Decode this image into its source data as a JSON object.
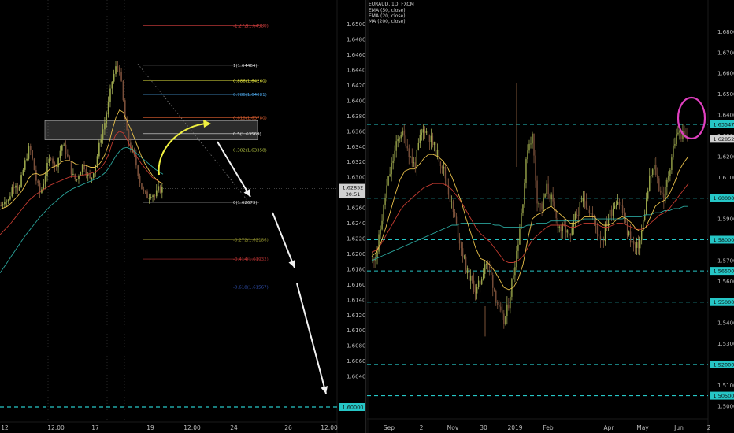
{
  "chart_data": [
    {
      "type": "candlestick",
      "panel": "left",
      "x_tick_labels": [
        "12",
        "12:00",
        "17",
        "19",
        "12:00",
        "24",
        "26",
        "12:00"
      ],
      "y_tick_labels": [
        "1.65000",
        "1.64800",
        "1.64600",
        "1.64400",
        "1.64200",
        "1.64000",
        "1.63800",
        "1.63600",
        "1.63400",
        "1.63200",
        "1.63000",
        "1.62800",
        "1.62600",
        "1.62400",
        "1.62200",
        "1.62000",
        "1.61800",
        "1.61600",
        "1.61400",
        "1.61200",
        "1.61000",
        "1.60800",
        "1.60600",
        "1.60400"
      ],
      "ylim": [
        1.6,
        1.6513
      ],
      "price_tag": {
        "price": 1.62852,
        "label": "1.62852",
        "countdown": "30:51"
      },
      "level_tag": {
        "price": 1.6,
        "label": "1.60000"
      },
      "fib_levels": [
        {
          "label": "-1.272(1.64980)",
          "price": 1.6498,
          "color": "#d84040"
        },
        {
          "label": "1(1.64464)",
          "price": 1.64464,
          "color": "#e0e0e0"
        },
        {
          "label": "0.886(1.64260)",
          "price": 1.6426,
          "color": "#e8e840"
        },
        {
          "label": "0.786(1.64081)",
          "price": 1.64081,
          "color": "#4aa0e0"
        },
        {
          "label": "0.618(1.63780)",
          "price": 1.6378,
          "color": "#e06030"
        },
        {
          "label": "0.5(1.63569)",
          "price": 1.63569,
          "color": "#e0e0e0"
        },
        {
          "label": "0.382(1.63358)",
          "price": 1.63358,
          "color": "#b0c040"
        },
        {
          "label": "0(1.62673)",
          "price": 1.62673,
          "color": "#e0e0e0"
        },
        {
          "label": "-0.272(1.62186)",
          "price": 1.62186,
          "color": "#9a9a30"
        },
        {
          "label": "-0.414(1.61932)",
          "price": 1.61932,
          "color": "#b03030"
        },
        {
          "label": "-0.618(1.61567)",
          "price": 1.61567,
          "color": "#3050b0"
        }
      ],
      "zone": {
        "top": 1.6374,
        "bottom": 1.6349
      },
      "dashed_level": 1.6,
      "series": [
        {
          "key": "price_path",
          "values": [
            1.6263,
            1.6272,
            1.6268,
            1.6285,
            1.6295,
            1.6282,
            1.6305,
            1.6325,
            1.634,
            1.6318,
            1.6292,
            1.6278,
            1.6296,
            1.6315,
            1.633,
            1.6312,
            1.6325,
            1.6343,
            1.6335,
            1.632,
            1.6302,
            1.6295,
            1.6308,
            1.6318,
            1.6305,
            1.6295,
            1.6312,
            1.633,
            1.6355,
            1.6372,
            1.6395,
            1.6425,
            1.6442,
            1.6446,
            1.6405,
            1.636,
            1.634,
            1.633,
            1.6312,
            1.629,
            1.6278,
            1.6275,
            1.628,
            1.6275,
            1.6284,
            1.6285
          ]
        },
        {
          "key": "ema50",
          "values": [
            1.6225,
            1.623,
            1.6235,
            1.624,
            1.6246,
            1.6252,
            1.6258,
            1.6264,
            1.627,
            1.6274,
            1.6278,
            1.6281,
            1.6284,
            1.6287,
            1.629,
            1.6292,
            1.6294,
            1.6296,
            1.6298,
            1.63,
            1.6301,
            1.6301,
            1.6302,
            1.6303,
            1.6304,
            1.6305,
            1.6307,
            1.6309,
            1.6313,
            1.632,
            1.633,
            1.6345,
            1.6356,
            1.636,
            1.6358,
            1.635,
            1.634,
            1.6332,
            1.6325,
            1.6318,
            1.6312,
            1.6306,
            1.63,
            1.6297,
            1.6294,
            1.6292
          ]
        },
        {
          "key": "ema20",
          "values": [
            1.6258,
            1.626,
            1.6262,
            1.6266,
            1.6271,
            1.6276,
            1.6282,
            1.629,
            1.6299,
            1.6304,
            1.6305,
            1.6303,
            1.6304,
            1.6307,
            1.6312,
            1.6314,
            1.6316,
            1.632,
            1.6322,
            1.6322,
            1.632,
            1.6317,
            1.6316,
            1.6316,
            1.6315,
            1.6313,
            1.6313,
            1.6315,
            1.6321,
            1.633,
            1.6343,
            1.6362,
            1.6378,
            1.6388,
            1.6385,
            1.6374,
            1.6364,
            1.6352,
            1.634,
            1.6328,
            1.6318,
            1.631,
            1.6303,
            1.6298,
            1.6294,
            1.6292
          ]
        },
        {
          "key": "ma200",
          "values": [
            1.6175,
            1.6182,
            1.6189,
            1.6196,
            1.6203,
            1.621,
            1.6217,
            1.6224,
            1.623,
            1.6236,
            1.6242,
            1.6248,
            1.6253,
            1.6258,
            1.6263,
            1.6267,
            1.6271,
            1.6275,
            1.6279,
            1.6282,
            1.6285,
            1.6287,
            1.6289,
            1.6291,
            1.6293,
            1.6295,
            1.6297,
            1.6299,
            1.6302,
            1.6306,
            1.6312,
            1.632,
            1.6328,
            1.6334,
            1.6338,
            1.6339,
            1.6337,
            1.6334,
            1.633,
            1.6326,
            1.6322,
            1.6318,
            1.6314,
            1.631,
            1.6307,
            1.6304
          ]
        }
      ]
    },
    {
      "type": "candlestick",
      "panel": "right",
      "title": "EURAUD, 1D, FXCM",
      "legend": [
        "EMA (50, close)",
        "EMA (20, close)",
        "MA (200, close)"
      ],
      "x_tick_labels": [
        "Sep",
        "2",
        "Nov",
        "30",
        "2019",
        "Feb",
        "Apr",
        "May",
        "Jun",
        "2"
      ],
      "y_tick_labels": [
        "1.68000",
        "1.67000",
        "1.66000",
        "1.65000",
        "1.64000",
        "1.63000",
        "1.62000",
        "1.61000",
        "1.60000",
        "1.59000",
        "1.58000",
        "1.57000",
        "1.56000",
        "1.55000",
        "1.54000",
        "1.53000",
        "1.52000",
        "1.51000",
        "1.50000"
      ],
      "ylim": [
        1.495,
        1.6915
      ],
      "price_tag": {
        "price": 1.62852,
        "label": "1.62852"
      },
      "dashed_levels": [
        {
          "price": 1.63547,
          "label": "1.63547"
        },
        {
          "price": 1.6,
          "label": "1.60000"
        },
        {
          "price": 1.58,
          "label": "1.58000"
        },
        {
          "price": 1.565,
          "label": "1.56500"
        },
        {
          "price": 1.55,
          "label": "1.55000"
        },
        {
          "price": 1.52,
          "label": "1.52000"
        },
        {
          "price": 1.505,
          "label": "1.50500"
        }
      ],
      "series": [
        {
          "key": "price_path",
          "values": [
            1.57,
            1.575,
            1.59,
            1.605,
            1.615,
            1.625,
            1.632,
            1.628,
            1.62,
            1.615,
            1.628,
            1.634,
            1.63,
            1.625,
            1.62,
            1.615,
            1.605,
            1.595,
            1.585,
            1.575,
            1.565,
            1.56,
            1.555,
            1.56,
            1.57,
            1.565,
            1.555,
            1.545,
            1.54,
            1.55,
            1.565,
            1.58,
            1.6,
            1.625,
            1.63,
            1.6,
            1.595,
            1.605,
            1.6,
            1.59,
            1.585,
            1.585,
            1.58,
            1.59,
            1.595,
            1.6,
            1.595,
            1.59,
            1.583,
            1.58,
            1.59,
            1.595,
            1.6,
            1.595,
            1.585,
            1.58,
            1.575,
            1.58,
            1.595,
            1.61,
            1.615,
            1.605,
            1.6,
            1.612,
            1.625,
            1.632,
            1.63,
            1.628
          ]
        },
        {
          "key": "ema50",
          "values": [
            1.574,
            1.575,
            1.578,
            1.582,
            1.586,
            1.59,
            1.594,
            1.597,
            1.599,
            1.601,
            1.603,
            1.605,
            1.606,
            1.607,
            1.607,
            1.607,
            1.606,
            1.604,
            1.601,
            1.598,
            1.594,
            1.59,
            1.586,
            1.583,
            1.581,
            1.579,
            1.576,
            1.573,
            1.57,
            1.569,
            1.569,
            1.57,
            1.572,
            1.576,
            1.58,
            1.582,
            1.584,
            1.586,
            1.587,
            1.587,
            1.587,
            1.587,
            1.586,
            1.586,
            1.587,
            1.588,
            1.588,
            1.588,
            1.587,
            1.586,
            1.586,
            1.587,
            1.588,
            1.588,
            1.587,
            1.586,
            1.585,
            1.585,
            1.586,
            1.588,
            1.59,
            1.592,
            1.593,
            1.595,
            1.598,
            1.601,
            1.604,
            1.607
          ]
        },
        {
          "key": "ema20",
          "values": [
            1.572,
            1.574,
            1.579,
            1.586,
            1.594,
            1.602,
            1.609,
            1.613,
            1.614,
            1.614,
            1.616,
            1.619,
            1.621,
            1.621,
            1.62,
            1.618,
            1.615,
            1.61,
            1.604,
            1.598,
            1.59,
            1.583,
            1.576,
            1.571,
            1.57,
            1.568,
            1.565,
            1.561,
            1.557,
            1.556,
            1.557,
            1.561,
            1.568,
            1.58,
            1.59,
            1.592,
            1.593,
            1.595,
            1.596,
            1.594,
            1.592,
            1.59,
            1.588,
            1.588,
            1.589,
            1.591,
            1.591,
            1.591,
            1.589,
            1.587,
            1.587,
            1.588,
            1.59,
            1.591,
            1.59,
            1.588,
            1.585,
            1.584,
            1.586,
            1.591,
            1.596,
            1.598,
            1.599,
            1.602,
            1.607,
            1.613,
            1.617,
            1.62
          ]
        },
        {
          "key": "ma200",
          "values": [
            1.57,
            1.571,
            1.572,
            1.573,
            1.574,
            1.575,
            1.576,
            1.577,
            1.578,
            1.579,
            1.58,
            1.581,
            1.582,
            1.583,
            1.584,
            1.585,
            1.586,
            1.587,
            1.587,
            1.588,
            1.588,
            1.588,
            1.588,
            1.588,
            1.588,
            1.588,
            1.587,
            1.587,
            1.586,
            1.586,
            1.586,
            1.586,
            1.586,
            1.587,
            1.587,
            1.588,
            1.588,
            1.588,
            1.589,
            1.589,
            1.589,
            1.589,
            1.589,
            1.589,
            1.589,
            1.59,
            1.59,
            1.59,
            1.59,
            1.59,
            1.59,
            1.59,
            1.59,
            1.59,
            1.591,
            1.591,
            1.591,
            1.591,
            1.592,
            1.592,
            1.593,
            1.593,
            1.594,
            1.594,
            1.595,
            1.595,
            1.596,
            1.596
          ]
        }
      ]
    }
  ]
}
